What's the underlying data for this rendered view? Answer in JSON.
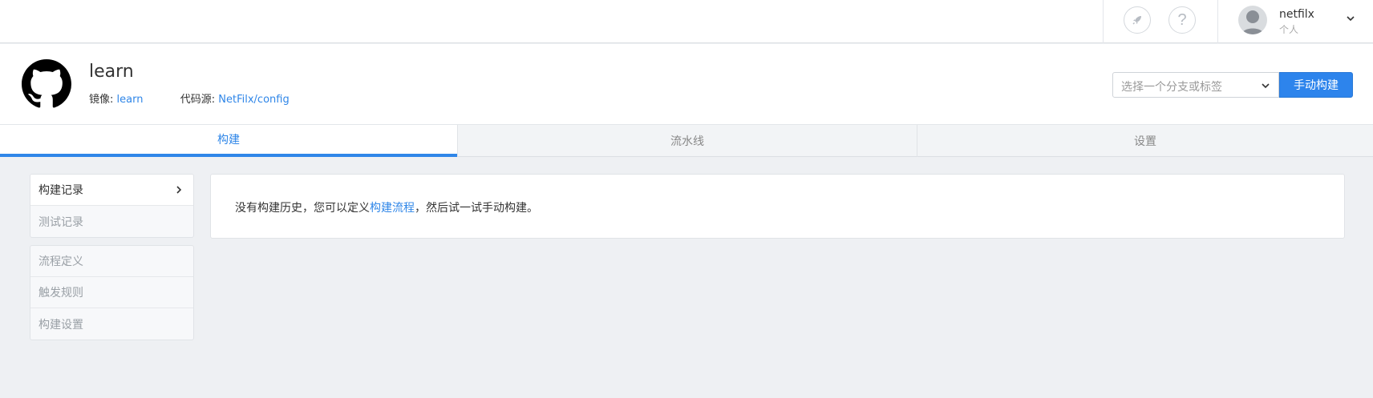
{
  "topbar": {
    "rocket_icon": "rocket-icon",
    "help_label": "?",
    "user": {
      "name": "netfilx",
      "subtitle": "个人"
    }
  },
  "repo": {
    "title": "learn",
    "mirror_label": "镜像:",
    "mirror_value": "learn",
    "source_label": "代码源:",
    "source_value": "NetFilx/config"
  },
  "branch_select": {
    "placeholder": "选择一个分支或标签"
  },
  "build_button": {
    "label": "手动构建"
  },
  "tabs": [
    {
      "label": "构建",
      "active": true
    },
    {
      "label": "流水线",
      "active": false
    },
    {
      "label": "设置",
      "active": false
    }
  ],
  "sidebar": {
    "group1": [
      {
        "label": "构建记录",
        "active": true
      },
      {
        "label": "测试记录",
        "active": false
      }
    ],
    "group2": [
      {
        "label": "流程定义"
      },
      {
        "label": "触发规则"
      },
      {
        "label": "构建设置"
      }
    ]
  },
  "main": {
    "msg_before": "没有构建历史，您可以定义",
    "msg_link": "构建流程",
    "msg_after": "，然后试一试手动构建。"
  },
  "colors": {
    "accent": "#2f86e8",
    "button": "#2d84ec",
    "background": "#eef0f3"
  }
}
